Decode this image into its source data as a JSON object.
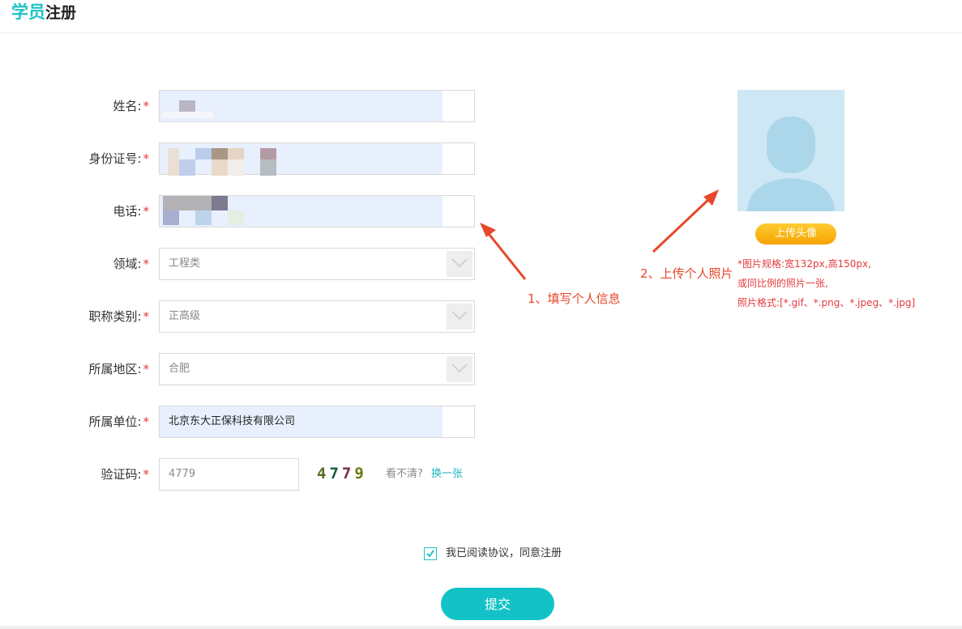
{
  "header": {
    "title_accent": "学员",
    "title_rest": "注册"
  },
  "form": {
    "name_label": "姓名:",
    "id_label": "身份证号:",
    "phone_label": "电话:",
    "field_label": "领域:",
    "field_value": "工程类",
    "title_label": "职称类别:",
    "title_value": "正高级",
    "region_label": "所属地区:",
    "region_value": "合肥",
    "company_label": "所属单位:",
    "company_value": "北京东大正保科技有限公司",
    "captcha_label": "验证码:",
    "captcha_value": "4779",
    "captcha_image_text": "4779",
    "unclear_text": "看不清?",
    "refresh_label": "换一张",
    "required_mark": "*"
  },
  "avatar": {
    "upload_label": "上传头像",
    "spec_line1": "*图片规格:宽132px,高150px,",
    "spec_line2": "或同比例的照片一张,",
    "spec_line3": "照片格式:[*.gif、*.png、*.jpeg、*.jpg]"
  },
  "annotations": {
    "step1": "1、填写个人信息",
    "step2": "2、上传个人照片"
  },
  "agreement": {
    "label": "我已阅读协议，同意注册",
    "checked": true
  },
  "submit_label": "提交",
  "colors": {
    "accent": "#1fc2c6",
    "required": "#e4393c",
    "annotation": "#e8472a",
    "upload": "#f5a300"
  },
  "icons": {
    "select_arrow": "chevron-down-icon",
    "checkbox": "check-icon",
    "avatar_placeholder": "user-silhouette-icon"
  }
}
